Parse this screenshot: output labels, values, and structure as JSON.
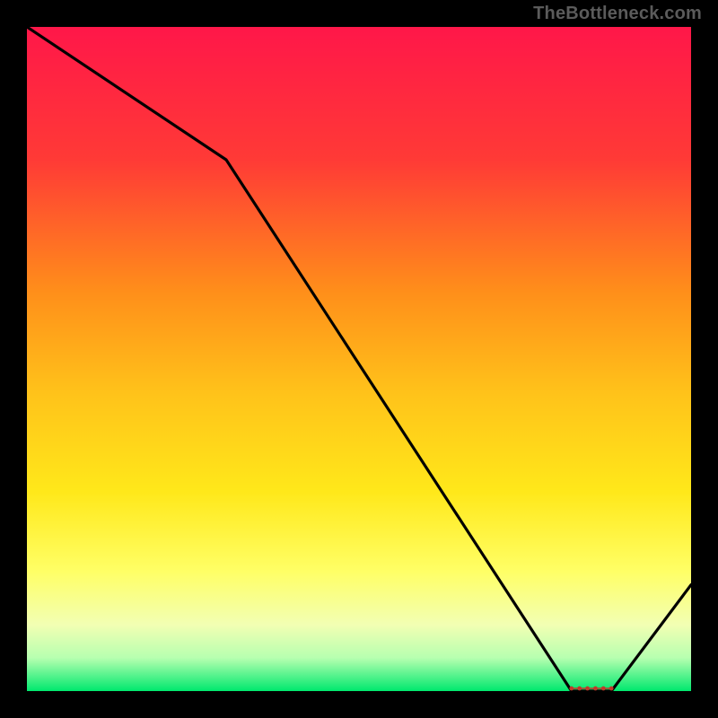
{
  "watermark": "TheBottleneck.com",
  "chart_data": {
    "type": "line",
    "title": "",
    "xlabel": "",
    "ylabel": "",
    "xlim": [
      0,
      100
    ],
    "ylim": [
      0,
      100
    ],
    "x": [
      0,
      30,
      82,
      88,
      100
    ],
    "values": [
      100,
      80,
      0,
      0,
      16
    ],
    "valley_markers_x": [
      82,
      83.2,
      84.4,
      85.6,
      86.8,
      88
    ],
    "gradient_stops": [
      {
        "offset": 0,
        "color": "#ff1749"
      },
      {
        "offset": 20,
        "color": "#ff3a36"
      },
      {
        "offset": 40,
        "color": "#ff8f1a"
      },
      {
        "offset": 55,
        "color": "#ffc21a"
      },
      {
        "offset": 70,
        "color": "#ffe81a"
      },
      {
        "offset": 82,
        "color": "#ffff66"
      },
      {
        "offset": 90,
        "color": "#f2ffb3"
      },
      {
        "offset": 95,
        "color": "#b7ffb0"
      },
      {
        "offset": 100,
        "color": "#00e86e"
      }
    ]
  }
}
